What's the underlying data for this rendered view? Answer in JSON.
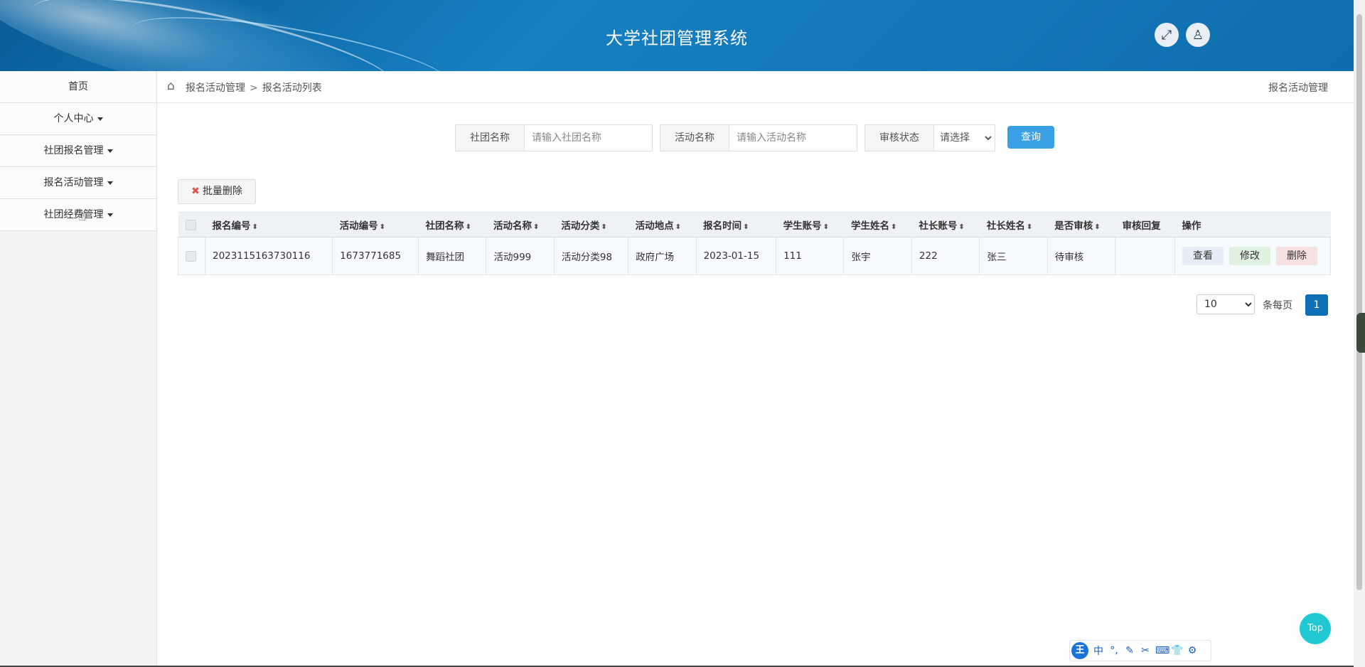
{
  "header": {
    "title": "大学社团管理系统",
    "fullscreen_icon": "⤢",
    "user_icon": "♙"
  },
  "sidebar": {
    "items": [
      {
        "label": "首页",
        "caret": false
      },
      {
        "label": "个人中心",
        "caret": true
      },
      {
        "label": "社团报名管理",
        "caret": true
      },
      {
        "label": "报名活动管理",
        "caret": true
      },
      {
        "label": "社团经费管理",
        "caret": true
      }
    ]
  },
  "breadcrumb": {
    "home_icon": "⌂",
    "level1": "报名活动管理",
    "separator": ">",
    "level2": "报名活动列表",
    "right": "报名活动管理"
  },
  "search": {
    "club_label": "社团名称",
    "club_placeholder": "请输入社团名称",
    "activity_label": "活动名称",
    "activity_placeholder": "请输入活动名称",
    "status_label": "审核状态",
    "status_selected": "请选择",
    "query_button": "查询"
  },
  "batch_delete": {
    "icon": "✖",
    "label": "批量删除"
  },
  "table": {
    "sort_icon": "⬍",
    "columns": [
      {
        "label": "报名编号",
        "sortable": true
      },
      {
        "label": "活动编号",
        "sortable": true
      },
      {
        "label": "社团名称",
        "sortable": true
      },
      {
        "label": "活动名称",
        "sortable": true
      },
      {
        "label": "活动分类",
        "sortable": true
      },
      {
        "label": "活动地点",
        "sortable": true
      },
      {
        "label": "报名时间",
        "sortable": true
      },
      {
        "label": "学生账号",
        "sortable": true
      },
      {
        "label": "学生姓名",
        "sortable": true
      },
      {
        "label": "社长账号",
        "sortable": true
      },
      {
        "label": "社长姓名",
        "sortable": true
      },
      {
        "label": "是否审核",
        "sortable": true
      },
      {
        "label": "审核回复",
        "sortable": false
      },
      {
        "label": "操作",
        "sortable": false
      }
    ],
    "rows": [
      {
        "cells": [
          "2023115163730116",
          "1673771685",
          "舞蹈社团",
          "活动999",
          "活动分类98",
          "政府广场",
          "2023-01-15",
          "111",
          "张宇",
          "222",
          "张三",
          "待审核",
          ""
        ],
        "actions": {
          "view": "查看",
          "edit": "修改",
          "delete": "删除"
        }
      }
    ]
  },
  "pager": {
    "page_size": "10",
    "per_page_label": "条每页",
    "current_page": "1"
  },
  "top_button": "Top",
  "ime": {
    "logo": "王",
    "items": [
      "中",
      "°,",
      "✎",
      "✂",
      "⌨",
      "👕",
      "⚙"
    ]
  }
}
